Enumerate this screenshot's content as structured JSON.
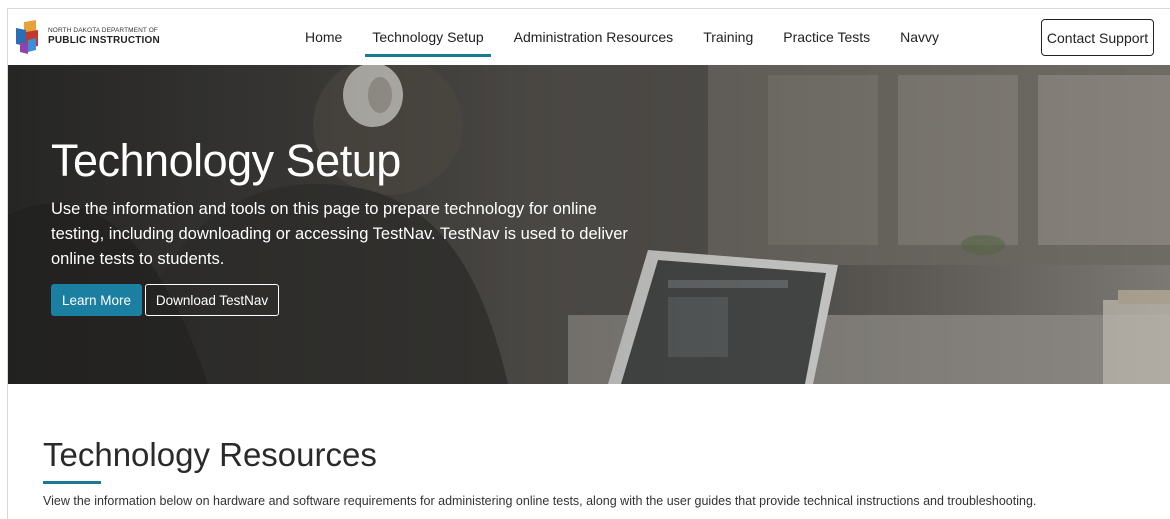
{
  "logo": {
    "small_text": "NORTH DAKOTA DEPARTMENT OF",
    "big_text": "PUBLIC INSTRUCTION",
    "colors": [
      "#e8a13a",
      "#c0392b",
      "#2c6db5",
      "#8e44ad"
    ]
  },
  "nav": {
    "items": [
      {
        "label": "Home",
        "active": false
      },
      {
        "label": "Technology Setup",
        "active": true
      },
      {
        "label": "Administration Resources",
        "active": false
      },
      {
        "label": "Training",
        "active": false
      },
      {
        "label": "Practice Tests",
        "active": false
      },
      {
        "label": "Navvy",
        "active": false
      }
    ],
    "active_color": "#1a7a94"
  },
  "contact_button": {
    "label": "Contact Support"
  },
  "hero": {
    "title": "Technology Setup",
    "description": "Use the information and tools on this page to prepare technology for online testing, including downloading or accessing TestNav. TestNav is used to deliver online tests to students.",
    "learn_more_label": "Learn More",
    "download_label": "Download TestNav",
    "button_color": "#1a7fa0"
  },
  "resources": {
    "title": "Technology Resources",
    "description": "View the information below on hardware and software requirements for administering online tests, along with the user guides that provide technical instructions and troubleshooting."
  }
}
